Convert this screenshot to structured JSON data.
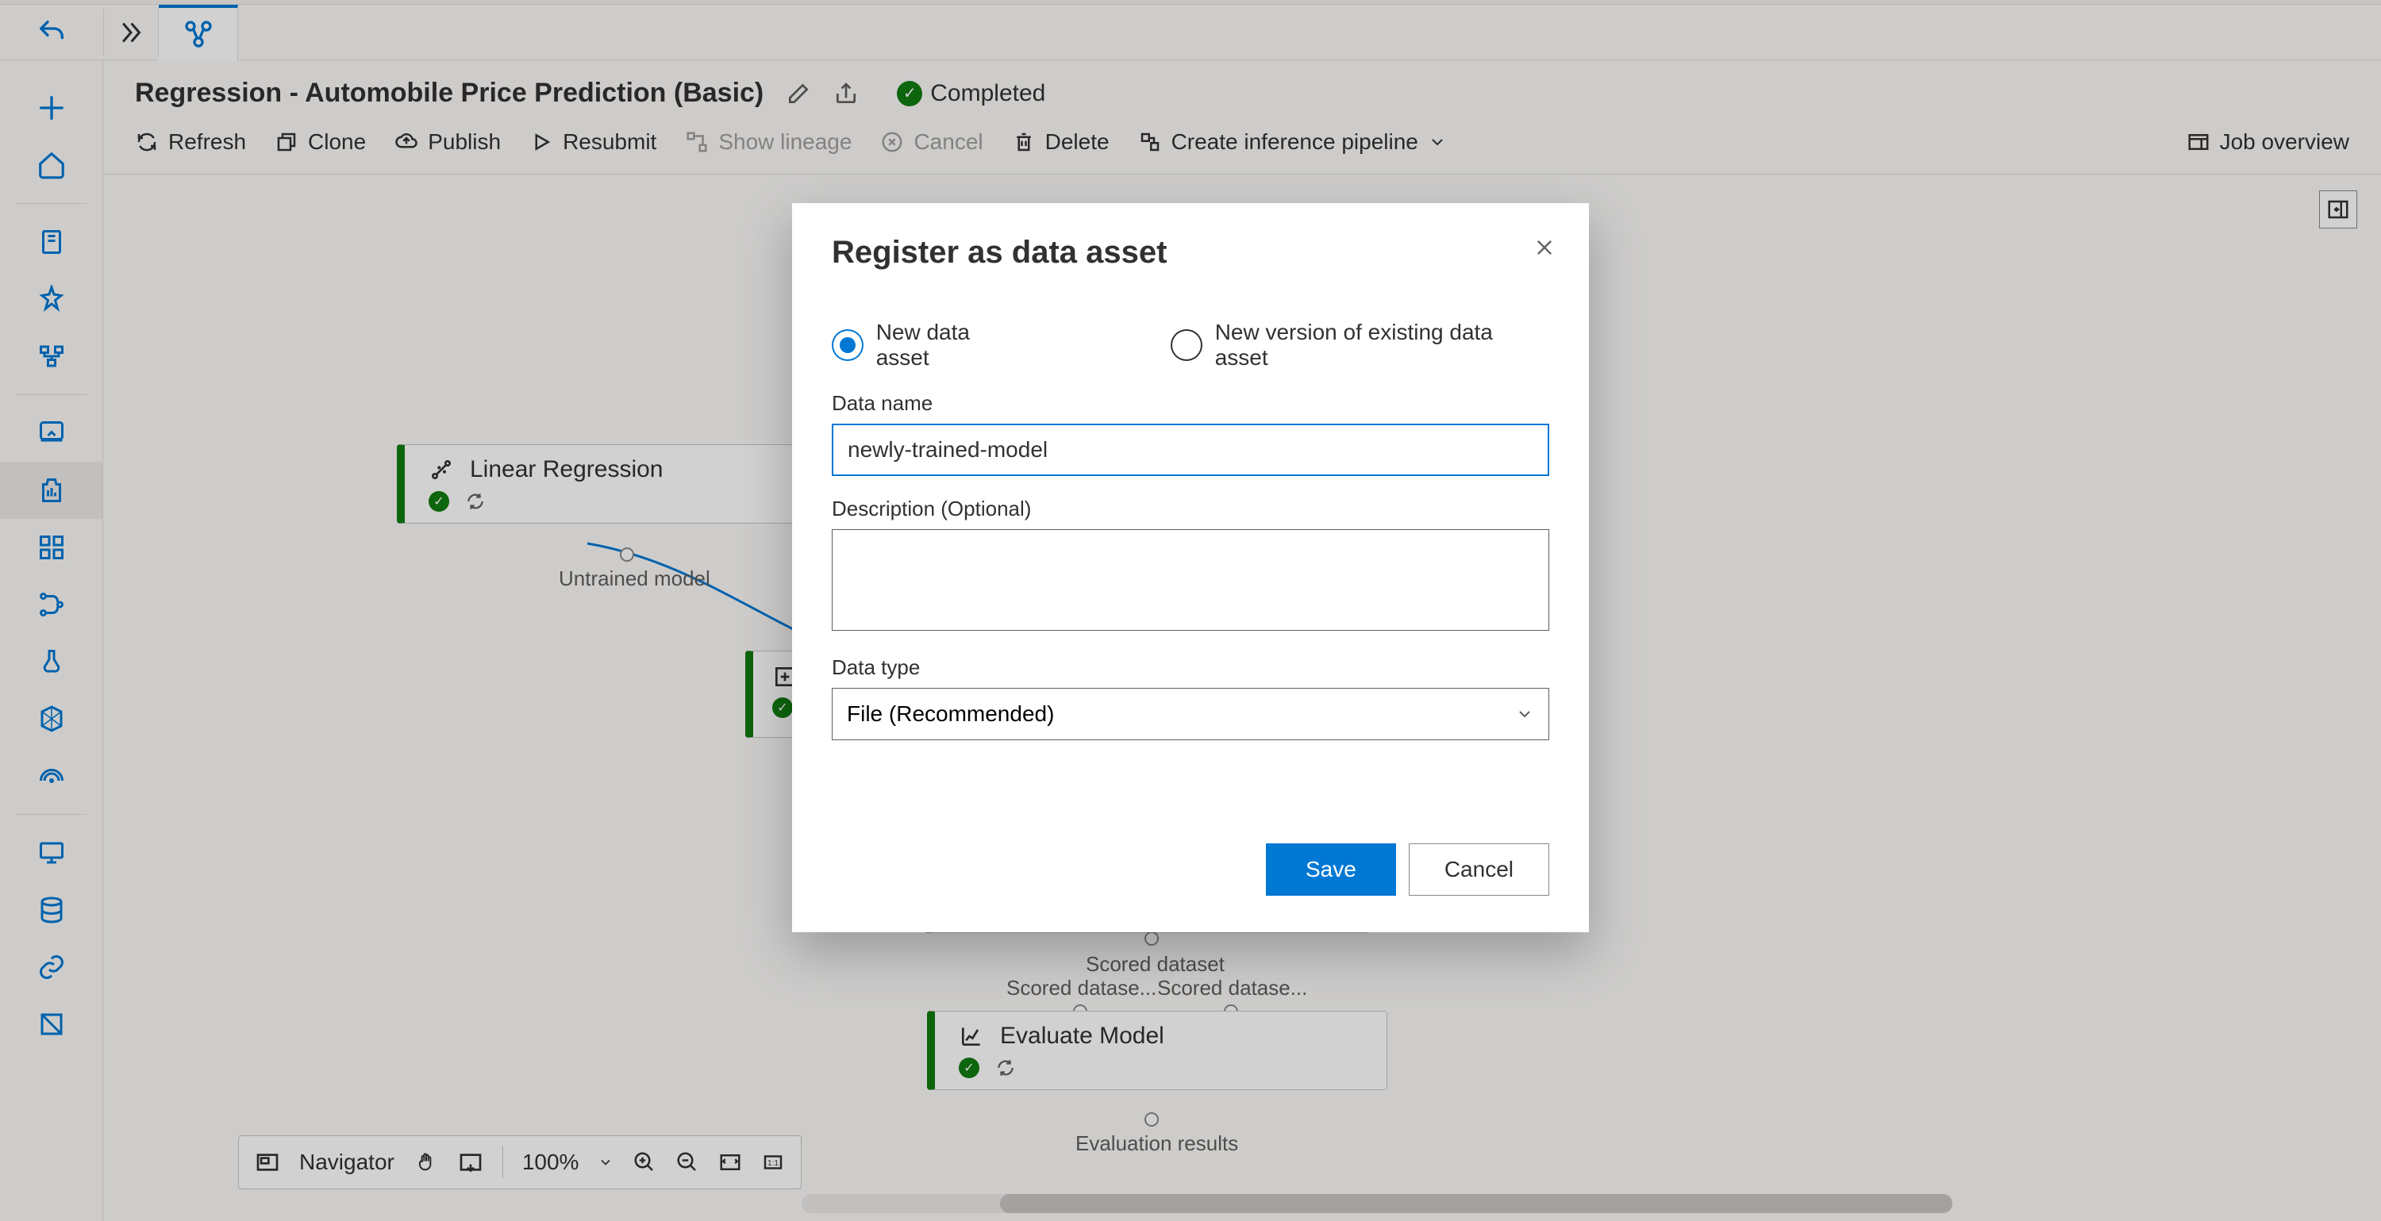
{
  "page": {
    "title": "Regression - Automobile Price Prediction (Basic)",
    "status": "Completed"
  },
  "toolbar": {
    "refresh": "Refresh",
    "clone": "Clone",
    "publish": "Publish",
    "resubmit": "Resubmit",
    "show_lineage": "Show lineage",
    "cancel": "Cancel",
    "delete": "Delete",
    "create_inference": "Create inference pipeline",
    "job_overview": "Job overview"
  },
  "nodes": {
    "linear_regression": "Linear Regression",
    "evaluate_model": "Evaluate Model"
  },
  "ports": {
    "untrained_model": "Untrained model",
    "scored_dataset": "Scored dataset",
    "scored_dataset_left": "Scored datase...",
    "scored_dataset_right": "Scored datase...",
    "evaluation_results": "Evaluation results"
  },
  "navigator": {
    "label": "Navigator",
    "zoom": "100%"
  },
  "modal": {
    "title": "Register as data asset",
    "radio_new": "New data asset",
    "radio_existing": "New version of existing data asset",
    "data_name_label": "Data name",
    "data_name_value": "newly-trained-model",
    "description_label": "Description (Optional)",
    "data_type_label": "Data type",
    "data_type_value": "File (Recommended)",
    "save": "Save",
    "cancel": "Cancel"
  }
}
